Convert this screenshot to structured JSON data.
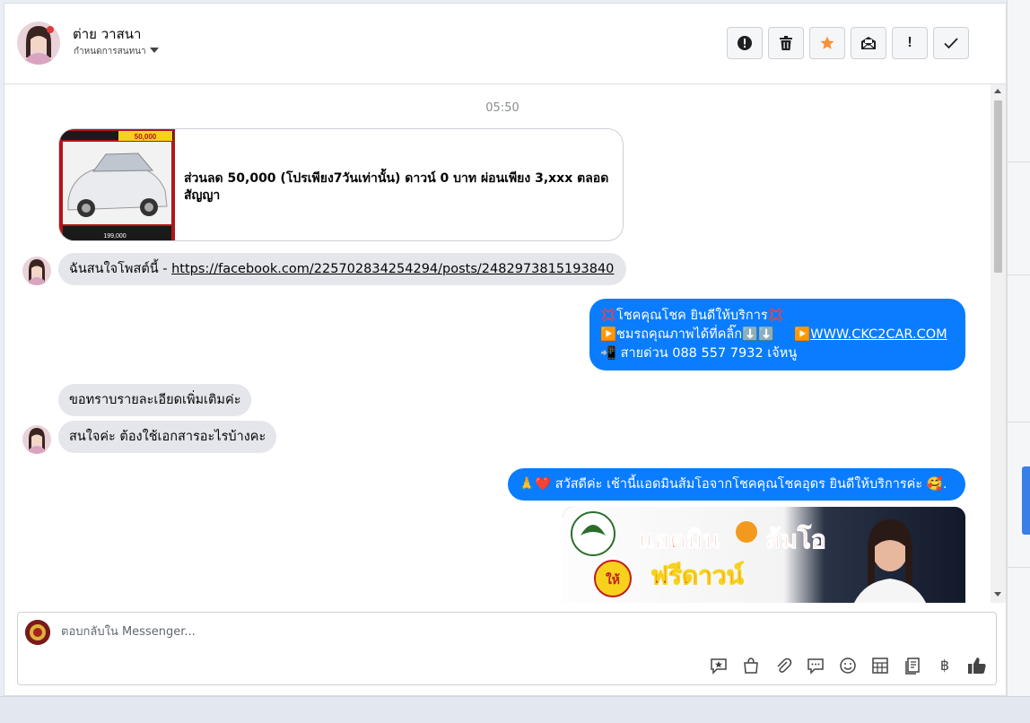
{
  "header": {
    "contact_name": "ต่าย วาสนา",
    "assign_label": "กำหนดการสนทนา",
    "actions": [
      {
        "icon": "alert-circle-icon",
        "name": "report-button"
      },
      {
        "icon": "trash-icon",
        "name": "delete-button"
      },
      {
        "icon": "star-icon",
        "name": "star-button",
        "color": "#f7923b"
      },
      {
        "icon": "mark-unread-icon",
        "name": "mark-unread-button"
      },
      {
        "icon": "exclamation-icon",
        "name": "spam-button"
      },
      {
        "icon": "check-icon",
        "name": "done-button"
      }
    ]
  },
  "conversation": {
    "timestamp": "05:50",
    "post_card": {
      "title": "ส่วนลด 50,000 (โปรเพียง7วันเท่านั้น) ดาวน์ 0 บาท ผ่อนเพียง 3,xxx ตลอดสัญญา",
      "thumb_text_price": "50,000",
      "thumb_text_bottom": "199,000"
    },
    "messages": [
      {
        "side": "in",
        "text": "ฉันสนใจโพสต์นี้ - ",
        "link": "https://facebook.com/225702834254294/posts/2482973815193840"
      },
      {
        "side": "out",
        "line1": "💢โชคคุณโชค ยินดีให้บริการ💢",
        "line2a": "▶️ชมรถคุณภาพได้ที่คลิ๊ก⬇️⬇️",
        "line2b": "▶️",
        "line2_link": "WWW.CKC2CAR.COM",
        "line3": "📲 สายด่วน 088 557 7932 เจ้หนู"
      },
      {
        "side": "in",
        "text": "ขอทราบรายละเอียดเพิ่มเติมค่ะ"
      },
      {
        "side": "in",
        "text": "สนใจค่ะ ต้องใช้เอกสารอะไรบ้างคะ"
      },
      {
        "side": "out",
        "text": "🙏❤️ สวัสดีค่ะ เช้านี้แอดมินส้มโอจากโชคคุณโชคอุดร ยินดีให้บริการค่ะ 🥰."
      }
    ],
    "promo_image": {
      "line1": "แอดมิน",
      "line1b": "ส้มโอ",
      "badge": "ให้",
      "line2": "ฟรีดาวน์"
    }
  },
  "composer": {
    "placeholder": "ตอบกลับใน Messenger...",
    "tools": [
      "saved-reply-icon",
      "shop-bag-icon",
      "attachment-icon",
      "chat-bubble-icon",
      "emoji-icon",
      "table-icon",
      "notes-icon",
      "baht-icon",
      "like-icon"
    ],
    "baht_symbol": "฿"
  },
  "colors": {
    "outgoing_bubble": "#0a7cff",
    "incoming_bubble": "#e4e6eb",
    "star": "#f7923b"
  }
}
